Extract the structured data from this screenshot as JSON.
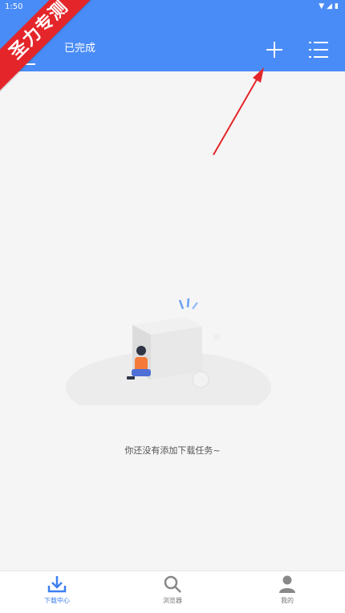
{
  "status_bar": {
    "time": "1:50",
    "icons": [
      "wifi-icon",
      "signal-icon",
      "battery-icon"
    ]
  },
  "header": {
    "tabs": [
      {
        "label": "",
        "active": true
      },
      {
        "label": "已完成",
        "active": false
      }
    ],
    "actions": [
      "add-icon",
      "list-menu-icon"
    ],
    "background": "#4a8cf7"
  },
  "watermark": {
    "text": "圣力专测",
    "color": "#e4262a"
  },
  "empty_state": {
    "message": "你还没有添加下载任务~"
  },
  "bottom_nav": {
    "items": [
      {
        "label": "下载中心",
        "icon": "download-icon",
        "active": true
      },
      {
        "label": "浏览器",
        "icon": "search-icon",
        "active": false
      },
      {
        "label": "我的",
        "icon": "person-icon",
        "active": false
      }
    ],
    "active_color": "#3d7ff0"
  }
}
